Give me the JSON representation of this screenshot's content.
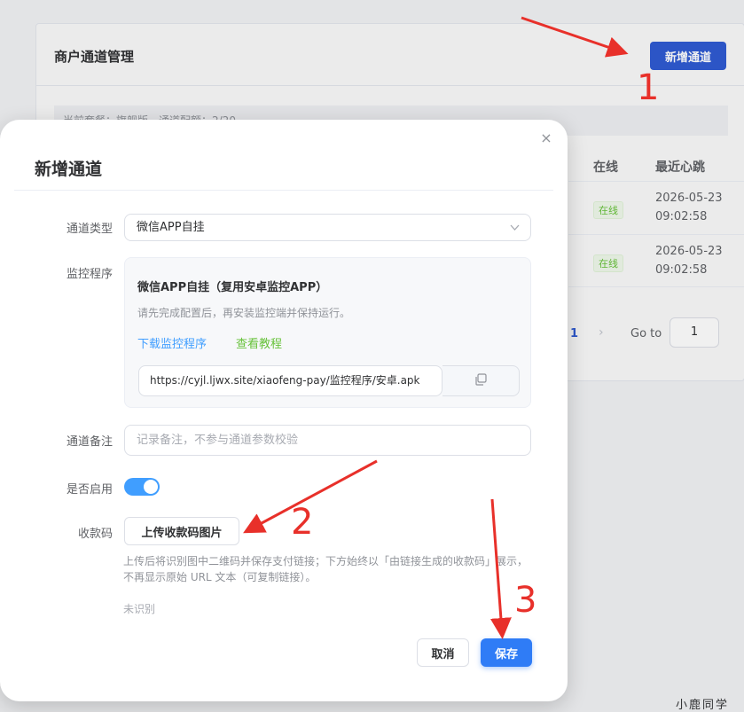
{
  "background": {
    "title": "商户通道管理",
    "add_button": "新增通道",
    "info_text": "当前套餐：旗舰版，通道配额：2/20",
    "table": {
      "col_online": "在线",
      "col_heartbeat": "最近心跳",
      "rows": [
        {
          "online": "在线",
          "heartbeat_date": "2026-05-23",
          "heartbeat_time": "09:02:58"
        },
        {
          "online": "在线",
          "heartbeat_date": "2026-05-23",
          "heartbeat_time": "09:02:58"
        }
      ]
    },
    "pagination": {
      "current_page": "1",
      "next": "›",
      "goto_label": "Go to",
      "goto_value": "1"
    }
  },
  "dialog": {
    "title": "新增通道",
    "close": "×",
    "labels": {
      "channel_type": "通道类型",
      "monitor": "监控程序",
      "remark": "通道备注",
      "enabled": "是否启用",
      "qrcode": "收款码"
    },
    "channel_type_value": "微信APP自挂",
    "monitor": {
      "title": "微信APP自挂（复用安卓监控APP）",
      "desc": "请先完成配置后，再安装监控端并保持运行。",
      "download_link": "下载监控程序",
      "tutorial_link": "查看教程",
      "url": "https://cyjl.ljwx.site/xiaofeng-pay/监控程序/安卓.apk"
    },
    "remark_placeholder": "记录备注，不参与通道参数校验",
    "enabled": true,
    "upload_button": "上传收款码图片",
    "upload_hint": "上传后将识别图中二维码并保存支付链接；下方始终以「由链接生成的收款码」展示，不再显示原始 URL 文本（可复制链接）。",
    "unrecognized": "未识别",
    "cancel_button": "取消",
    "save_button": "保存"
  },
  "annotations": {
    "step1": "1",
    "step2": "2",
    "step3": "3",
    "color": "#e8302a"
  },
  "watermark": "小鹿同学",
  "colors": {
    "primary": "#2f7cf6",
    "link_blue": "#409eff",
    "link_green": "#67c23a"
  }
}
